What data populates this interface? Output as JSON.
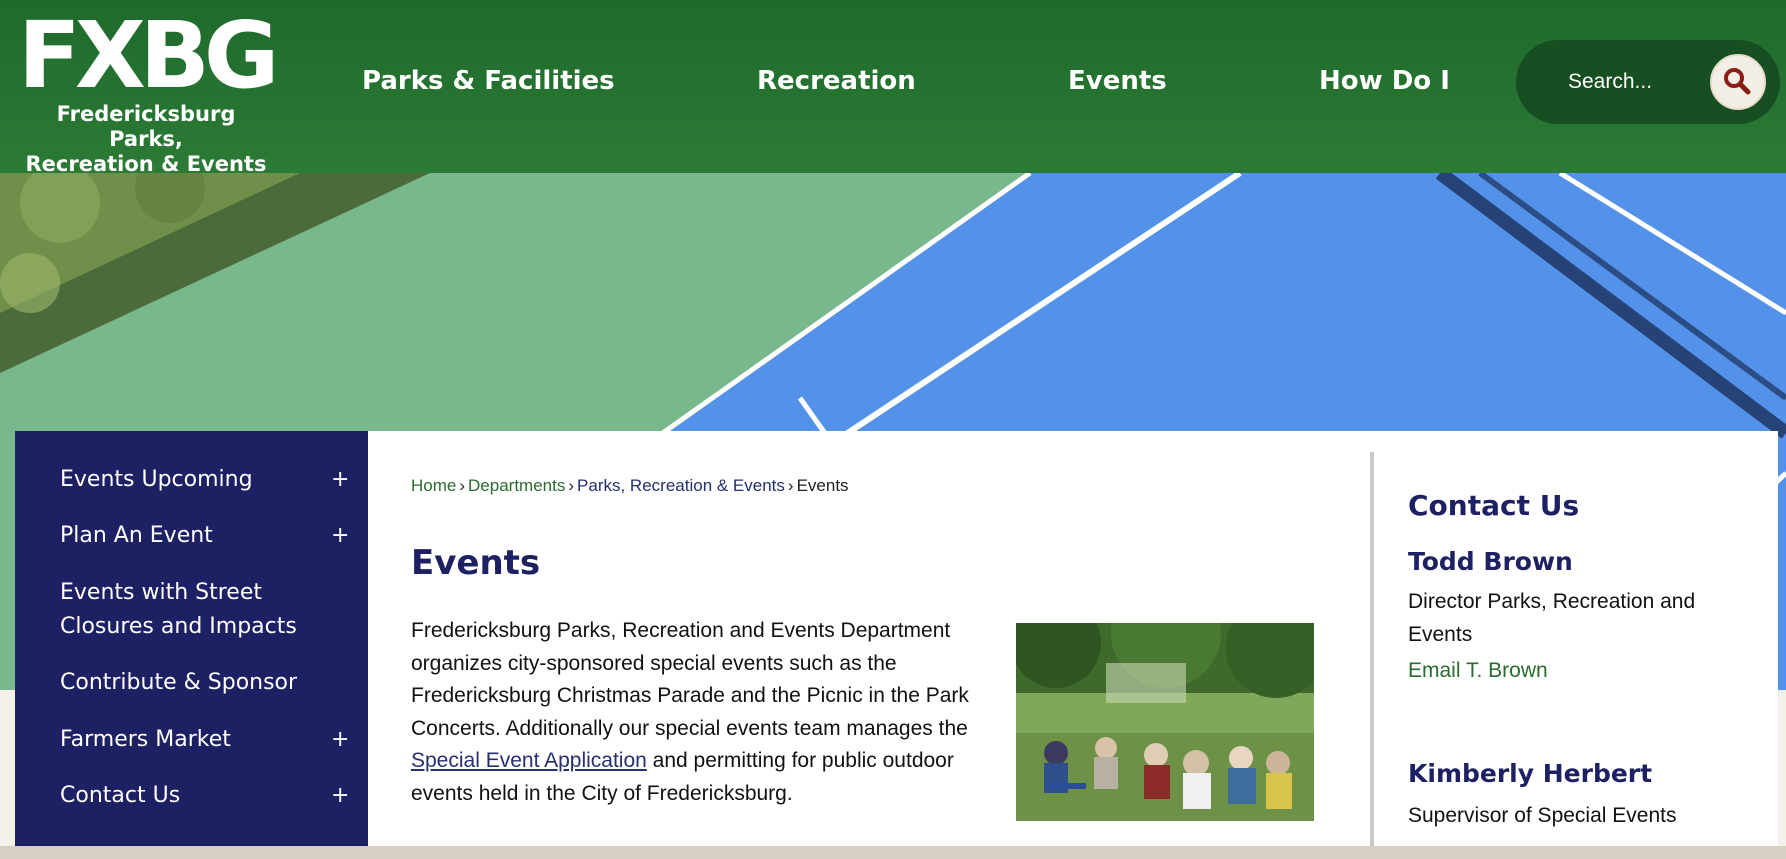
{
  "logo": {
    "mark": "FXBG",
    "subtitle_line1": "Fredericksburg Parks,",
    "subtitle_line2": "Recreation & Events"
  },
  "nav": {
    "items": [
      "Parks & Facilities",
      "Recreation",
      "Events",
      "How Do I"
    ]
  },
  "search": {
    "placeholder": "Search...",
    "icon": "search-icon"
  },
  "sidebar": {
    "items": [
      {
        "label": "Events Upcoming",
        "expand": "+"
      },
      {
        "label": "Plan An Event",
        "expand": "+"
      },
      {
        "label": "Events with Street Closures and Impacts",
        "expand": ""
      },
      {
        "label": "Contribute & Sponsor",
        "expand": ""
      },
      {
        "label": "Farmers Market",
        "expand": "+"
      },
      {
        "label": "Contact Us",
        "expand": "+"
      }
    ]
  },
  "breadcrumb": {
    "home": "Home",
    "departments": "Departments",
    "parks": "Parks, Recreation & Events",
    "current": "Events",
    "separator": "›"
  },
  "main": {
    "title": "Events",
    "paragraph_before": "Fredericksburg Parks, Recreation and Events Department organizes city-sponsored special events such as the Fredericksburg Christmas Parade and the Picnic in the Park Concerts. Additionally our special events team manages the",
    "link_text": "Special Event Application",
    "paragraph_after": "and permitting for public outdoor events held in the City of Fredericksburg."
  },
  "contact": {
    "title": "Contact Us",
    "people": [
      {
        "name": "Todd Brown",
        "role": "Director Parks, Recreation and Events",
        "email": "Email T. Brown"
      },
      {
        "name": "Kimberly Herbert",
        "role": "Supervisor of Special Events"
      }
    ]
  },
  "colors": {
    "header_green": "#1f6a2c",
    "search_green": "#174f22",
    "navy": "#1d2063",
    "link_green": "#2b6b2f"
  }
}
